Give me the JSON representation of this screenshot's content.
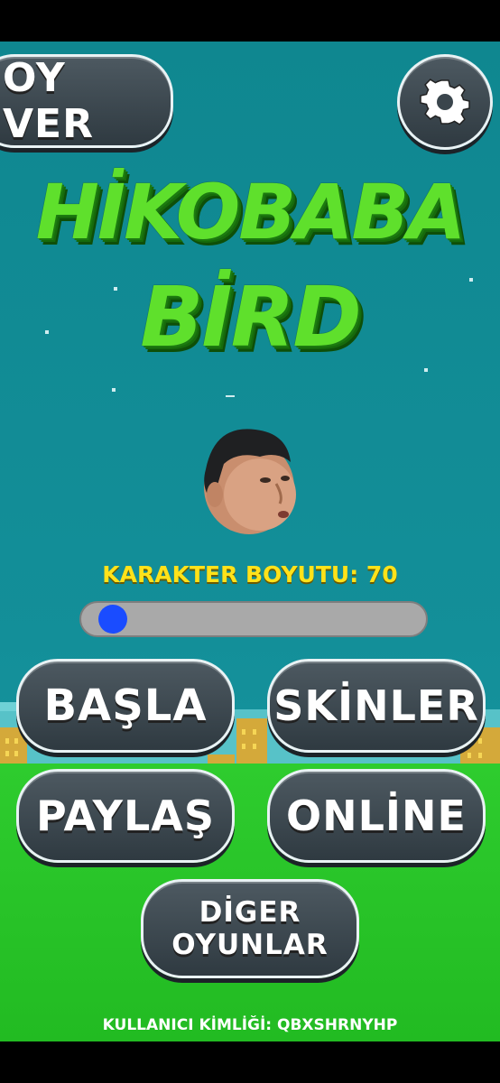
{
  "top_left_button": {
    "label": "OY VER"
  },
  "settings": {
    "icon": "gear-icon"
  },
  "title": {
    "line1": "HİKOBABA",
    "line2": "BİRD"
  },
  "character": {
    "icon": "character-face"
  },
  "size": {
    "label": "KARAKTER BOYUTU: 70",
    "value": 70,
    "slider_fraction": 0.05
  },
  "menu": {
    "start": "BAŞLA",
    "skins": "SKİNLER",
    "share": "PAYLAŞ",
    "online": "ONLİNE",
    "other_line1": "DİGER",
    "other_line2": "OYUNLAR"
  },
  "footer": {
    "user_id": "KULLANICI KİMLİĞİ: QBXSHRNYHP"
  },
  "colors": {
    "accent_yellow": "#ffe21a",
    "title_green": "#5fe02c",
    "button_dark": "#3a454c",
    "sky": "#138f99",
    "ground": "#2ecc2e"
  }
}
